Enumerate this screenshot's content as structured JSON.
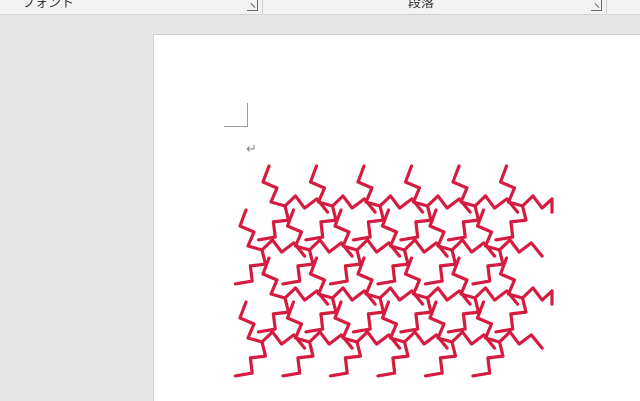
{
  "ribbon": {
    "groups": [
      {
        "label": "フォント"
      },
      {
        "label": "段落"
      }
    ]
  },
  "document": {
    "paragraph_mark": "↵",
    "pattern": {
      "stroke_color": "#d51b3f",
      "rows": 4,
      "columns": 6,
      "description_icon": "tomoe-tessellation-graphic"
    }
  }
}
